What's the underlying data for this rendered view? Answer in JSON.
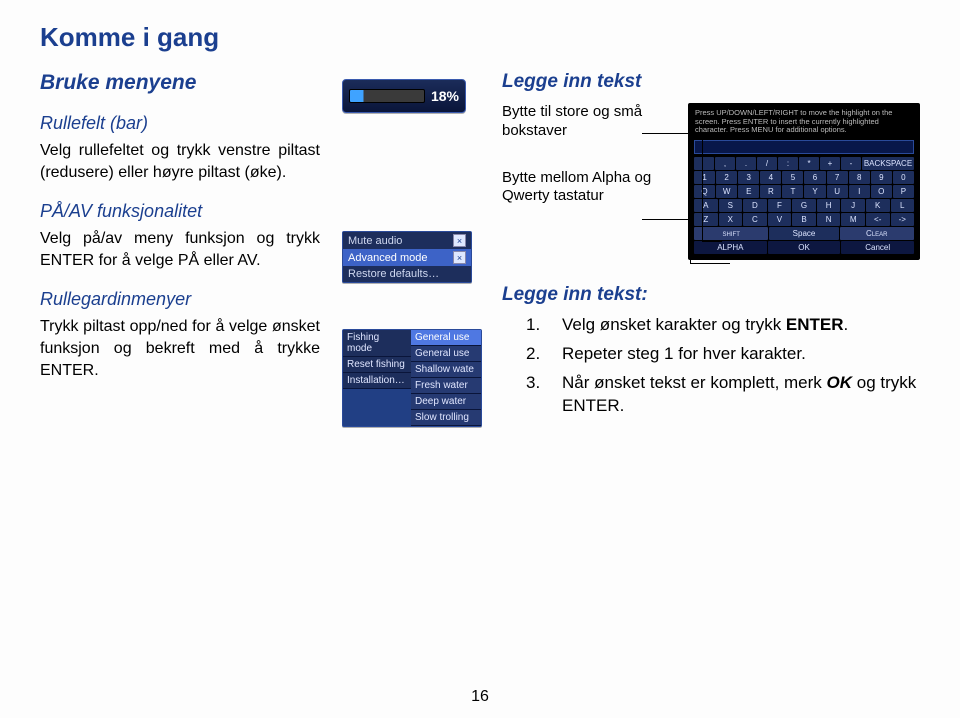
{
  "title": "Komme i gang",
  "left": {
    "use_menus": "Bruke menyene",
    "rolle_head": "Rullefelt (bar)",
    "rolle_para": "Velg rullefeltet og trykk venstre piltast (redusere) eller høyre piltast (øke).",
    "onoff_head": "PÅ/AV funksjonalitet",
    "onoff_para": "Velg på/av meny funksjon og trykk ENTER for å velge PÅ eller AV.",
    "drop_head": "Rullegardinmenyer",
    "drop_para": "Trykk piltast opp/ned for å velge ønsket funksjon og bekreft med å trykke ENTER."
  },
  "mid": {
    "slider_value": "18%",
    "menu_items": [
      {
        "label": "Mute audio",
        "checked": true
      },
      {
        "label": "Advanced mode",
        "checked": true,
        "hi": true
      },
      {
        "label": "Restore defaults…",
        "checked": false
      }
    ],
    "drop_labels": [
      "Fishing mode",
      "Reset fishing",
      "Installation…"
    ],
    "drop_opts": [
      {
        "t": "General use",
        "hi": true
      },
      {
        "t": "General use"
      },
      {
        "t": "Shallow wate"
      },
      {
        "t": "Fresh water"
      },
      {
        "t": "Deep water"
      },
      {
        "t": "Slow trolling"
      }
    ]
  },
  "right": {
    "legge_head": "Legge inn tekst",
    "case_label": "Bytte til store og små bokstaver",
    "layout_label": "Bytte mellom Alpha og Qwerty tastatur",
    "kb_hint": "Press UP/DOWN/LEFT/RIGHT to move the highlight on the screen.\nPress ENTER to insert the currently highlighted character. Press MENU for additional options.",
    "kb_rows": [
      [
        " ",
        ",",
        ".",
        "/",
        ":",
        "*",
        "+",
        "-",
        "BACKSPACE"
      ],
      [
        "1",
        "2",
        "3",
        "4",
        "5",
        "6",
        "7",
        "8",
        "9",
        "0"
      ],
      [
        "Q",
        "W",
        "E",
        "R",
        "T",
        "Y",
        "U",
        "I",
        "O",
        "P"
      ],
      [
        "A",
        "S",
        "D",
        "F",
        "G",
        "H",
        "J",
        "K",
        "L"
      ],
      [
        "Z",
        "X",
        "C",
        "V",
        "B",
        "N",
        "M",
        "<-",
        "->"
      ]
    ],
    "kb_shift": "shift",
    "kb_space": "Space",
    "kb_clear": "Clear",
    "kb_footer": [
      "ALPHA",
      "OK",
      "Cancel"
    ],
    "steps_head": "Legge inn tekst:",
    "steps": [
      {
        "n": "1.",
        "t": "Velg ønsket karakter og trykk ",
        "b": "ENTER",
        "tail": "."
      },
      {
        "n": "2.",
        "t": "Repeter steg 1 for hver karakter."
      },
      {
        "n": "3.",
        "t": "Når ønsket tekst er komplett, merk ",
        "ok": "OK",
        "tail": " og trykk ENTER."
      }
    ]
  },
  "page_num": "16"
}
